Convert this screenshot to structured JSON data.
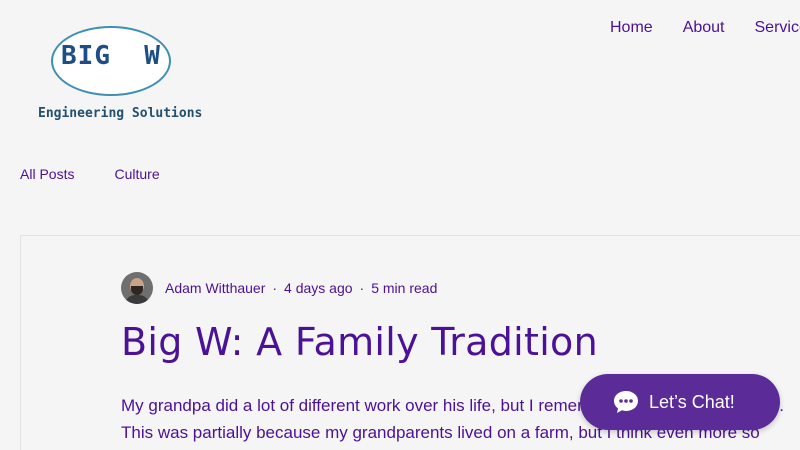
{
  "logo": {
    "title": "BIG  W",
    "subtitle": "Engineering Solutions"
  },
  "topnav": {
    "items": [
      "Home",
      "About",
      "Services"
    ]
  },
  "categories": [
    "All Posts",
    "Culture"
  ],
  "post": {
    "author": "Adam Witthauer",
    "date": "4 days ago",
    "read_time": "5 min read",
    "title": "Big W: A Family Tradition",
    "excerpt_line1": "My grandpa did a lot of different work over his life, but I remember him most as a farmer.",
    "excerpt_line2": "This was partially because my grandparents lived on a farm, but I think even more so"
  },
  "chat": {
    "label": "Let’s Chat!",
    "color": "#5b2c98"
  },
  "colors": {
    "accent": "#4b1196",
    "background": "#f5f5f6"
  }
}
